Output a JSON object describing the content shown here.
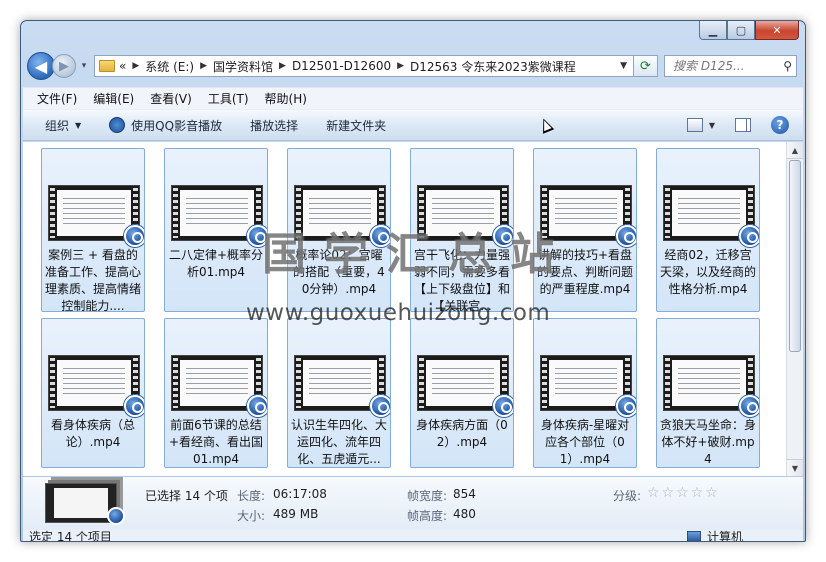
{
  "nav": {
    "back_glyph": "◀",
    "forward_glyph": "▶",
    "history_glyph": "▾",
    "overflow": "«",
    "breadcrumbs": [
      "系统 (E:)",
      "国学资料馆",
      "D12501-D12600",
      "D12563 令东来2023紫微课程"
    ],
    "search_placeholder": "搜索 D125..."
  },
  "menu": [
    "文件(F)",
    "编辑(E)",
    "查看(V)",
    "工具(T)",
    "帮助(H)"
  ],
  "toolbar": {
    "organize": "组织",
    "qq_play": "使用QQ影音播放",
    "play_selection": "播放选择",
    "new_folder": "新建文件夹"
  },
  "files": [
    "案例三 + 看盘的准备工作、提高心理素质、提高情绪控制能力....",
    "二八定律+概率分析01.mp4",
    "概率论02：宫曜的搭配（重要，40分钟）.mp4",
    "宫干飞化：力量强弱不同，需要多看【上下级盘位】和【关联宫...",
    "讲解的技巧+看盘的要点、判断问题的严重程度.mp4",
    "经商02，迁移宫天梁，以及经商的性格分析.mp4",
    "看身体疾病（总论）.mp4",
    "前面6节课的总结+看经商、看出国01.mp4",
    "认识生年四化、大运四化、流年四化、五虎遁元...",
    "身体疾病方面（02）.mp4",
    "身体疾病-星曜对应各个部位（01）.mp4",
    "贪狼天马坐命：身体不好+破财.mp4"
  ],
  "watermark": {
    "big": "国学汇总站",
    "url": "www.guoxuehuizong.com"
  },
  "details": {
    "selected": "已选择 14 个项",
    "length_label": "长度:",
    "length": "06:17:08",
    "size_label": "大小:",
    "size": "489 MB",
    "frame_width_label": "帧宽度:",
    "frame_width": "854",
    "frame_height_label": "帧高度:",
    "frame_height": "480",
    "rating_label": "分级:",
    "stars": "☆☆☆☆☆"
  },
  "status": {
    "left": "选定 14 个项目",
    "right": "计算机"
  }
}
